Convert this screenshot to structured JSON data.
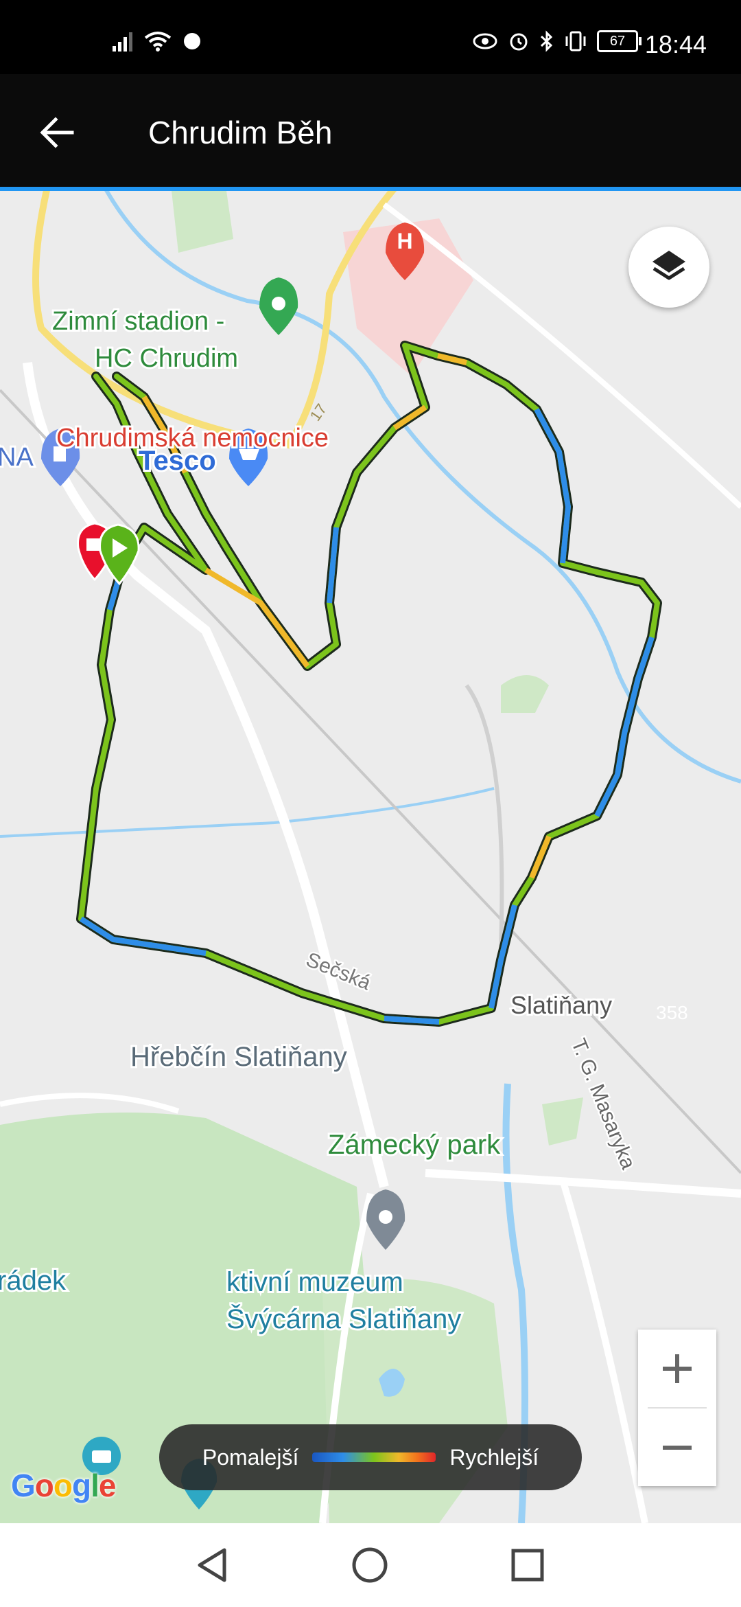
{
  "status_bar": {
    "time": "18:44",
    "battery": "67",
    "icons_left": [
      "signal-icon",
      "wifi-icon",
      "notification-icon"
    ],
    "icons_right": [
      "eye-icon",
      "alarm-icon",
      "bluetooth-icon",
      "vibrate-icon",
      "battery-icon"
    ]
  },
  "app_bar": {
    "title": "Chrudim Běh"
  },
  "map": {
    "labels": {
      "hospital": "Chrudimská nemocnice",
      "stadium_line1": "Zimní stadion -",
      "stadium_line2": "HC Chrudim",
      "gas_station": "NA",
      "tesco": "Tesco",
      "road_17": "17",
      "secska": "Sečská",
      "slatinany": "Slatiňany",
      "road_358": "358",
      "hrebcin": "Hřebčín Slatiňany",
      "masaryka": "T. G. Masaryka",
      "zamecky_park": "Zámecký park",
      "radek": "rádek",
      "muzeum": "ktivní muzeum",
      "svycarna": "Švýcárna Slatiňany"
    },
    "colors": {
      "route_green": "#7cc41c",
      "route_blue": "#2e8de8",
      "route_orange": "#f0b82a",
      "park_green": "#c8e6c0",
      "water": "#9ad0f5",
      "road_yellow": "#f7df79"
    }
  },
  "legend": {
    "slower": "Pomalejší",
    "faster": "Rychlejší"
  },
  "google_logo": [
    "G",
    "o",
    "o",
    "g",
    "l",
    "e"
  ]
}
